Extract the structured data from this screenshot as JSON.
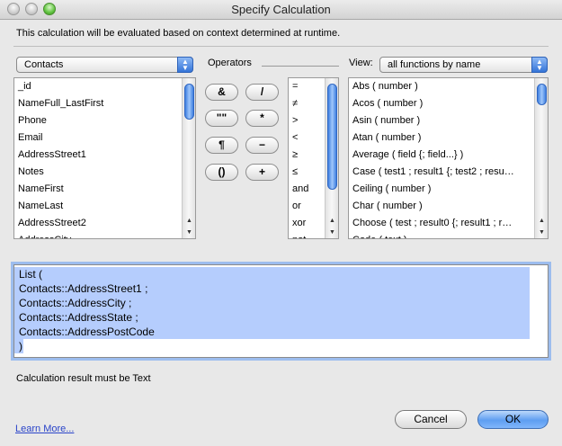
{
  "window": {
    "title": "Specify Calculation"
  },
  "hint": "This calculation will be evaluated based on context determined at runtime.",
  "table_popup": {
    "selected": "Contacts"
  },
  "operators_label": "Operators",
  "view_label": "View:",
  "view_popup": {
    "selected": "all functions by name"
  },
  "fields": [
    "_id",
    "NameFull_LastFirst",
    "Phone",
    "Email",
    "AddressStreet1",
    "Notes",
    "NameFirst",
    "NameLast",
    "AddressStreet2",
    "AddressCity"
  ],
  "operator_buttons": [
    "&",
    "/",
    "\"\"",
    "*",
    "¶",
    "−",
    "()",
    "+"
  ],
  "operator_list": [
    "=",
    "≠",
    ">",
    "<",
    "≥",
    "≤",
    "and",
    "or",
    "xor",
    "not"
  ],
  "functions": [
    "Abs ( number )",
    "Acos ( number )",
    "Asin ( number )",
    "Atan ( number )",
    "Average ( field {; field...} )",
    "Case ( test1 ; result1 {; test2 ; resu…",
    "Ceiling ( number )",
    "Char ( number )",
    "Choose ( test ; result0 {; result1 ; r…",
    "Code ( text )"
  ],
  "calculation": [
    "List (",
    "Contacts::AddressStreet1 ;",
    "Contacts::AddressCity ;",
    "Contacts::AddressState ;",
    "Contacts::AddressPostCode",
    ")"
  ],
  "result_label": "Calculation result must be Text",
  "learn_more": "Learn More...",
  "buttons": {
    "cancel": "Cancel",
    "ok": "OK"
  }
}
